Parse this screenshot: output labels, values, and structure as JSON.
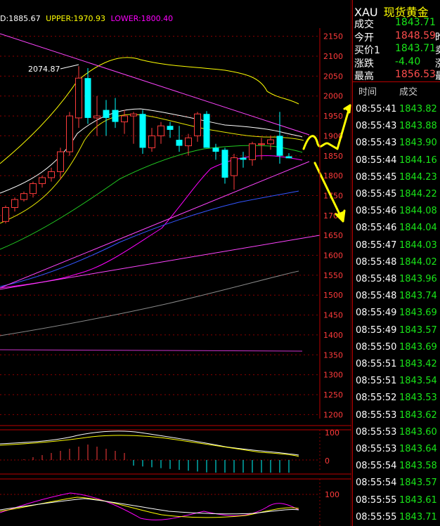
{
  "topbar": {
    "mid": "D:1885.67",
    "upper": "UPPER:1970.93",
    "lower": "LOWER:1800.40",
    "colors": {
      "mid": "#ffffff",
      "upper": "#ffff00",
      "lower": "#ff00ff"
    }
  },
  "peak_label": "2074.87",
  "panel": {
    "symbol": "XAU",
    "name": "现货黄金",
    "quote": [
      {
        "label": "成交",
        "value": "1843.71",
        "color": "#19e619",
        "cut": ""
      },
      {
        "label": "今开",
        "value": "1848.59",
        "color": "#ff4d4d",
        "cut": "昨"
      },
      {
        "label": "买价1",
        "value": "1843.71",
        "color": "#19e619",
        "cut": "卖"
      },
      {
        "label": "涨跌",
        "value": "-4.40",
        "color": "#19e619",
        "cut": "涨"
      },
      {
        "label": "最高",
        "value": "1856.53",
        "color": "#ff4d4d",
        "cut": "最"
      }
    ],
    "ticks_header": {
      "time": "时间",
      "trade": "成交"
    },
    "ticks": [
      {
        "time": "08:55:41",
        "price": "1843.82"
      },
      {
        "time": "08:55:43",
        "price": "1843.88"
      },
      {
        "time": "08:55:43",
        "price": "1843.90"
      },
      {
        "time": "08:55:44",
        "price": "1844.16"
      },
      {
        "time": "08:55:45",
        "price": "1844.23"
      },
      {
        "time": "08:55:45",
        "price": "1844.22"
      },
      {
        "time": "08:55:46",
        "price": "1844.08"
      },
      {
        "time": "08:55:46",
        "price": "1844.04"
      },
      {
        "time": "08:55:47",
        "price": "1844.03"
      },
      {
        "time": "08:55:48",
        "price": "1844.02"
      },
      {
        "time": "08:55:48",
        "price": "1843.96"
      },
      {
        "time": "08:55:48",
        "price": "1843.74"
      },
      {
        "time": "08:55:49",
        "price": "1843.69"
      },
      {
        "time": "08:55:49",
        "price": "1843.57"
      },
      {
        "time": "08:55:50",
        "price": "1843.69"
      },
      {
        "time": "08:55:51",
        "price": "1843.42"
      },
      {
        "time": "08:55:51",
        "price": "1843.54"
      },
      {
        "time": "08:55:52",
        "price": "1843.53"
      },
      {
        "time": "08:55:53",
        "price": "1843.62"
      },
      {
        "time": "08:55:53",
        "price": "1843.60"
      },
      {
        "time": "08:55:53",
        "price": "1843.64"
      },
      {
        "time": "08:55:54",
        "price": "1843.58"
      },
      {
        "time": "08:55:54",
        "price": "1843.57"
      },
      {
        "time": "08:55:55",
        "price": "1843.61"
      },
      {
        "time": "08:55:55",
        "price": "1843.71"
      }
    ]
  },
  "chart_data": {
    "type": "candlestick",
    "ylim": [
      1190,
      2160
    ],
    "yticks": [
      2150,
      2100,
      2050,
      2000,
      1950,
      1900,
      1850,
      1800,
      1750,
      1700,
      1650,
      1600,
      1550,
      1500,
      1450,
      1400,
      1350,
      1300,
      1250,
      1200
    ],
    "colors": {
      "up": "#ff3b3b",
      "down": "#00ffff",
      "grid": "#8b0000",
      "axis": "#ff3b3b"
    },
    "candles": [
      {
        "o": 1685,
        "h": 1725,
        "l": 1680,
        "c": 1720
      },
      {
        "o": 1720,
        "h": 1745,
        "l": 1710,
        "c": 1740
      },
      {
        "o": 1740,
        "h": 1760,
        "l": 1735,
        "c": 1755
      },
      {
        "o": 1755,
        "h": 1785,
        "l": 1745,
        "c": 1780
      },
      {
        "o": 1780,
        "h": 1800,
        "l": 1770,
        "c": 1795
      },
      {
        "o": 1795,
        "h": 1820,
        "l": 1785,
        "c": 1810
      },
      {
        "o": 1810,
        "h": 1870,
        "l": 1790,
        "c": 1860
      },
      {
        "o": 1860,
        "h": 1960,
        "l": 1850,
        "c": 1950
      },
      {
        "o": 1945,
        "h": 2075,
        "l": 1920,
        "c": 2045
      },
      {
        "o": 2045,
        "h": 2070,
        "l": 1930,
        "c": 1945
      },
      {
        "o": 1945,
        "h": 2000,
        "l": 1900,
        "c": 1950
      },
      {
        "o": 1965,
        "h": 1990,
        "l": 1900,
        "c": 1945
      },
      {
        "o": 1965,
        "h": 1995,
        "l": 1920,
        "c": 1935
      },
      {
        "o": 1935,
        "h": 1965,
        "l": 1905,
        "c": 1950
      },
      {
        "o": 1950,
        "h": 1960,
        "l": 1880,
        "c": 1955
      },
      {
        "o": 1955,
        "h": 1965,
        "l": 1855,
        "c": 1870
      },
      {
        "o": 1870,
        "h": 1920,
        "l": 1860,
        "c": 1900
      },
      {
        "o": 1900,
        "h": 1935,
        "l": 1880,
        "c": 1925
      },
      {
        "o": 1925,
        "h": 1935,
        "l": 1895,
        "c": 1915
      },
      {
        "o": 1890,
        "h": 1925,
        "l": 1860,
        "c": 1875
      },
      {
        "o": 1875,
        "h": 1905,
        "l": 1850,
        "c": 1895
      },
      {
        "o": 1900,
        "h": 1960,
        "l": 1885,
        "c": 1955
      },
      {
        "o": 1955,
        "h": 1962,
        "l": 1870,
        "c": 1870
      },
      {
        "o": 1870,
        "h": 1880,
        "l": 1840,
        "c": 1860
      },
      {
        "o": 1865,
        "h": 1870,
        "l": 1780,
        "c": 1795
      },
      {
        "o": 1800,
        "h": 1855,
        "l": 1765,
        "c": 1845
      },
      {
        "o": 1845,
        "h": 1860,
        "l": 1820,
        "c": 1840
      },
      {
        "o": 1840,
        "h": 1885,
        "l": 1825,
        "c": 1880
      },
      {
        "o": 1880,
        "h": 1895,
        "l": 1840,
        "c": 1880
      },
      {
        "o": 1880,
        "h": 1900,
        "l": 1865,
        "c": 1890
      },
      {
        "o": 1900,
        "h": 1960,
        "l": 1830,
        "c": 1850
      },
      {
        "o": 1848.59,
        "h": 1856.53,
        "l": 1843.42,
        "c": 1843.71
      }
    ]
  }
}
